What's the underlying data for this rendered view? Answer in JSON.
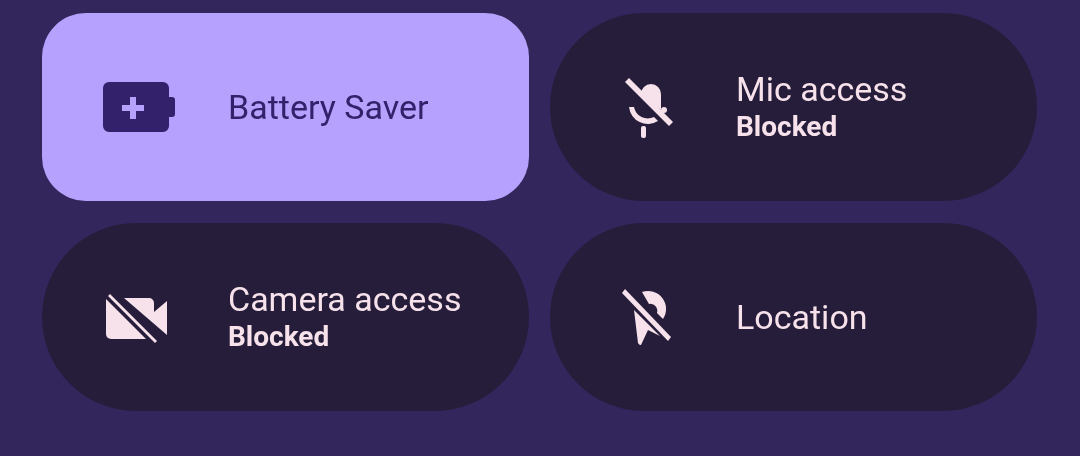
{
  "tiles": [
    {
      "kind": "battery",
      "label": "Battery Saver",
      "on": true
    },
    {
      "kind": "mic",
      "label": "Mic access",
      "secondary": "Blocked",
      "on": false
    },
    {
      "kind": "camera",
      "label": "Camera access",
      "secondary": "Blocked",
      "on": false
    },
    {
      "kind": "location",
      "label": "Location",
      "on": false
    }
  ]
}
